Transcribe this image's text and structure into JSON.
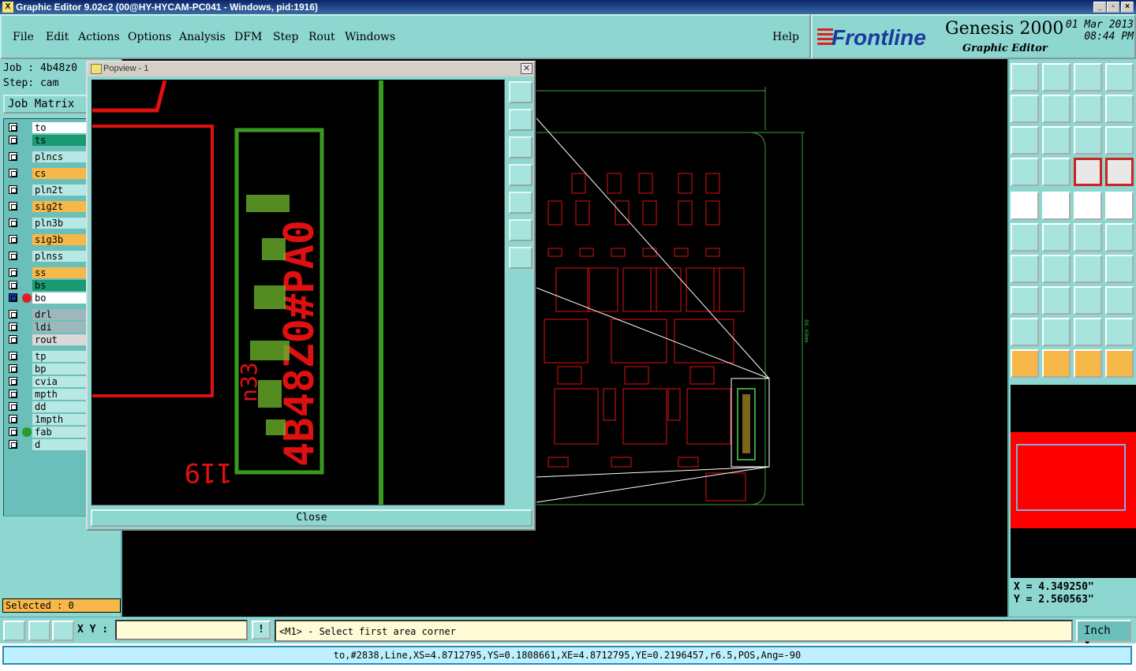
{
  "window": {
    "title": "Graphic Editor 9.02c2 (00@HY-HYCAM-PC041 - Windows, pid:1916)"
  },
  "menu": [
    "File",
    "Edit",
    "Actions",
    "Options",
    "Analysis",
    "DFM",
    "Step",
    "Rout",
    "Windows"
  ],
  "help_label": "Help",
  "brand": {
    "logo": "Frontline",
    "product": "Genesis 2000",
    "subtitle": "Graphic Editor",
    "date": "01 Mar 2013",
    "time": "08:44 PM"
  },
  "job": {
    "job_line": "Job : 4b48z0",
    "step_line": "Step: cam",
    "matrix_button": "Job Matrix"
  },
  "layers": [
    {
      "name": "to",
      "color": "#ffffff"
    },
    {
      "name": "ts",
      "color": "#1a9a70"
    },
    {
      "name": "plncs",
      "color": "#b8e8e4"
    },
    {
      "name": "cs",
      "color": "#f7b84a"
    },
    {
      "name": "pln2t",
      "color": "#b8e8e4"
    },
    {
      "name": "sig2t",
      "color": "#f7b84a"
    },
    {
      "name": "pln3b",
      "color": "#b8e8e4"
    },
    {
      "name": "sig3b",
      "color": "#f7b84a"
    },
    {
      "name": "plnss",
      "color": "#b8e8e4"
    },
    {
      "name": "ss",
      "color": "#f7b84a"
    },
    {
      "name": "bs",
      "color": "#1a9a70"
    },
    {
      "name": "bo",
      "color": "#ffffff"
    },
    {
      "name": "drl",
      "color": "#9cb8bc"
    },
    {
      "name": "ldi",
      "color": "#9cb8bc"
    },
    {
      "name": "rout",
      "color": "#d8d8d8"
    },
    {
      "name": "tp",
      "color": "#b8e8e4"
    },
    {
      "name": "bp",
      "color": "#b8e8e4"
    },
    {
      "name": "cvia",
      "color": "#b8e8e4"
    },
    {
      "name": "mpth",
      "color": "#b8e8e4"
    },
    {
      "name": "dd",
      "color": "#b8e8e4"
    },
    {
      "name": "1mpth",
      "color": "#b8e8e4"
    },
    {
      "name": "fab",
      "color": "#b8e8e4"
    },
    {
      "name": "d",
      "color": "#b8e8e4"
    }
  ],
  "selected_text": "Selected : 0",
  "popview": {
    "title": "Popview - 1",
    "close_label": "Close",
    "silk_text": "4B48Z0#PA0",
    "small_label": "119",
    "side_label": "n33"
  },
  "canvas_dim_label": "86.60mm",
  "coords": {
    "x": "X = 4.349250\"",
    "y": "Y = 2.560563\""
  },
  "xy_label": "X Y :",
  "prompt": "<M1> - Select first area corner",
  "unit": "Inch",
  "status": "to,#2838,Line,XS=4.8712795,YS=0.1808661,XE=4.8712795,YE=0.2196457,r6.5,POS,Ang=-90"
}
